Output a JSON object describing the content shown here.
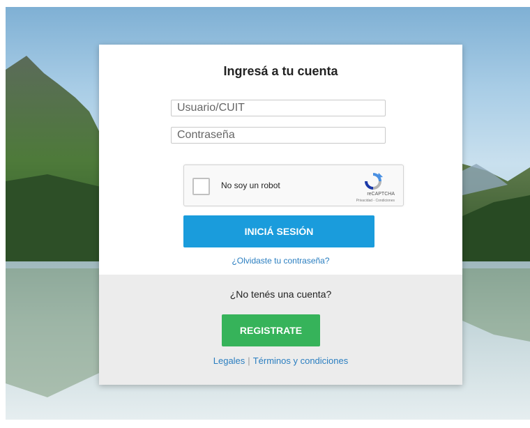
{
  "login": {
    "title": "Ingresá a tu cuenta",
    "username_placeholder": "Usuario/CUIT",
    "password_placeholder": "Contraseña",
    "captcha": {
      "label": "No soy un robot",
      "brand": "reCAPTCHA",
      "links": "Privacidad - Condiciones"
    },
    "login_button": "INICIÁ SESIÓN",
    "forgot_password": "¿Olvidaste tu contraseña?"
  },
  "signup": {
    "prompt": "¿No tenés una cuenta?",
    "register_button": "REGISTRATE"
  },
  "footer": {
    "legal": "Legales",
    "separator": "|",
    "terms": "Términos y condiciones"
  },
  "colors": {
    "primary_button": "#1a9cdc",
    "register_button": "#36b35a",
    "link": "#2a7ec0"
  },
  "icons": [
    "recaptcha-icon"
  ]
}
